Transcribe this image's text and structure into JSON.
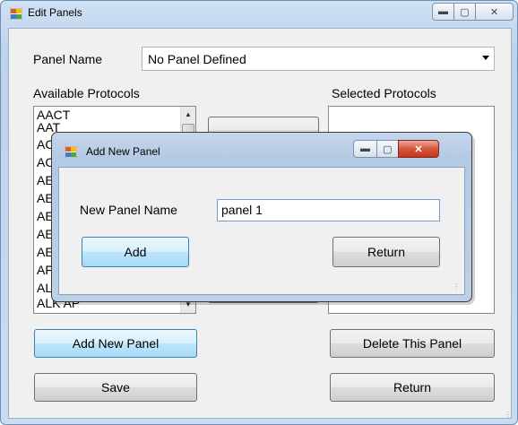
{
  "window": {
    "title": "Edit Panels"
  },
  "panel_name": {
    "label": "Panel Name",
    "value": "No Panel Defined"
  },
  "available": {
    "label": "Available Protocols",
    "items": [
      "AACT",
      "AAT",
      "AC",
      "AC",
      "AE",
      "AE",
      "AE",
      "AE",
      "AE",
      "AF",
      "AL",
      "ALK AP"
    ]
  },
  "selected": {
    "label": "Selected Protocols",
    "items": []
  },
  "buttons": {
    "add_new_panel": "Add New Panel",
    "delete_panel": "Delete This Panel",
    "save": "Save",
    "return": "Return"
  },
  "dialog": {
    "title": "Add New Panel",
    "name_label": "New Panel Name",
    "name_value": "panel 1",
    "add": "Add",
    "return": "Return"
  },
  "icons": [
    "app-icon",
    "minimize-icon",
    "maximize-icon",
    "close-icon",
    "scroll-up-icon",
    "scroll-down-icon",
    "dropdown-arrow-icon",
    "resize-grip-icon"
  ]
}
